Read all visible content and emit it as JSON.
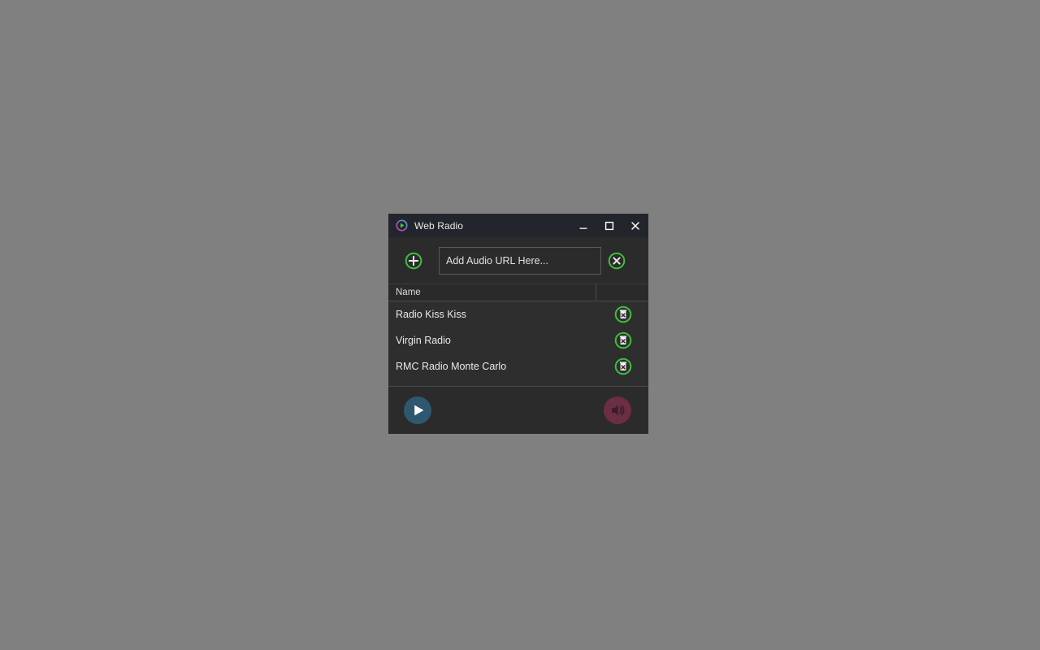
{
  "window": {
    "title": "Web Radio",
    "app_icon": "play-circle-icon",
    "controls": {
      "minimize": "minimize-icon",
      "maximize": "maximize-icon",
      "close": "close-icon"
    }
  },
  "toolbar": {
    "add_button": {
      "icon": "plus-circle-icon",
      "label": "Add"
    },
    "url_input": {
      "value": "",
      "placeholder": "Add Audio URL Here..."
    },
    "clear_button": {
      "icon": "close-circle-icon",
      "label": "Clear"
    }
  },
  "table": {
    "columns": [
      "Name",
      ""
    ],
    "rows": [
      {
        "name": "Radio Kiss Kiss",
        "delete_icon": "trash-delete-icon"
      },
      {
        "name": "Virgin Radio",
        "delete_icon": "trash-delete-icon"
      },
      {
        "name": "RMC Radio Monte Carlo",
        "delete_icon": "trash-delete-icon"
      }
    ]
  },
  "player": {
    "play_button": {
      "icon": "play-icon",
      "label": "Play"
    },
    "volume_button": {
      "icon": "volume-icon",
      "label": "Volume"
    }
  },
  "colors": {
    "desktop": "#808080",
    "titlebar": "#22262c",
    "window_body": "#2e2e2e",
    "toolbar": "#2b2b2b",
    "accent_green": "#39c13a",
    "play_blue": "#2c5a74",
    "volume_maroon": "#6b2e44",
    "text": "#e9e9e9"
  }
}
